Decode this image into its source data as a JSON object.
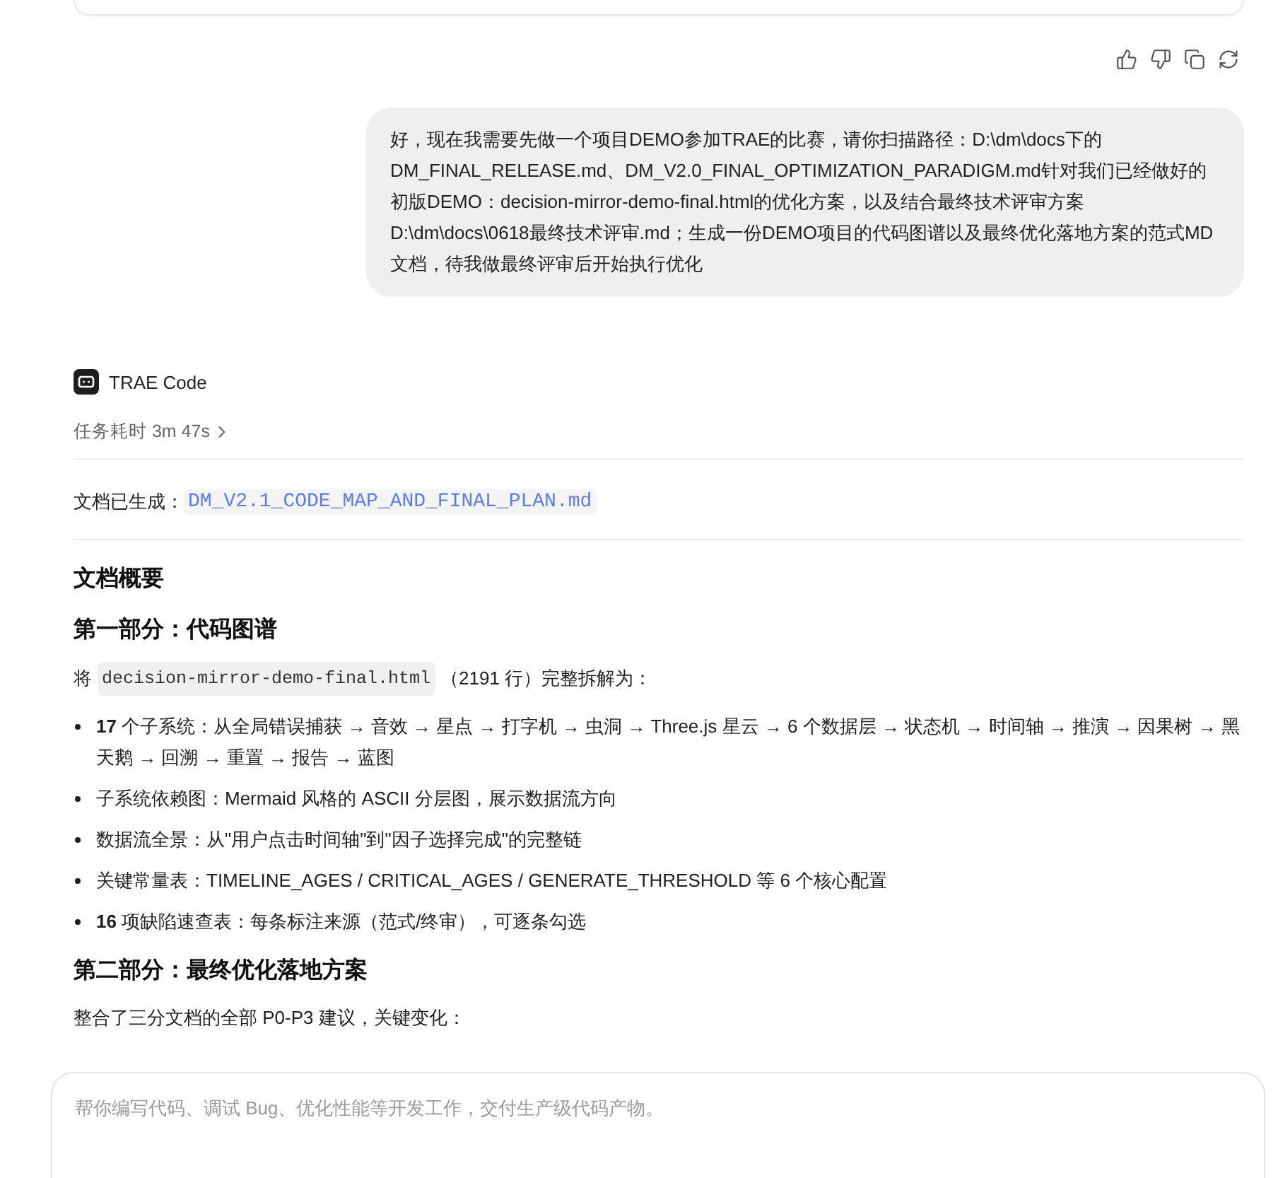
{
  "message_actions": [
    {
      "kind": "like"
    },
    {
      "kind": "dislike"
    },
    {
      "kind": "copy"
    },
    {
      "kind": "regenerate"
    }
  ],
  "user_message": {
    "text": "好，现在我需要先做一个项目DEMO参加TRAE的比赛，请你扫描路径：D:\\dm\\docs下的DM_FINAL_RELEASE.md、DM_V2.0_FINAL_OPTIMIZATION_PARADIGM.md针对我们已经做好的初版DEMO：decision-mirror-demo-final.html的优化方案，以及结合最终技术评审方案D:\\dm\\docs\\0618最终技术评审.md；生成一份DEMO项目的代码图谱以及最终优化落地方案的范式MD文档，待我做最终评审后开始执行优化"
  },
  "assistant": {
    "name": "TRAE Code",
    "duration": "任务耗时 3m 47s",
    "generated_label": "文档已生成：",
    "generated_file": "DM_V2.1_CODE_MAP_AND_FINAL_PLAN.md",
    "blocks": [
      {
        "kind": "heading",
        "text": "文档概要"
      },
      {
        "kind": "heading",
        "text": "第一部分：代码图谱"
      },
      {
        "kind": "code_paragraph",
        "before": "将",
        "code": "decision-mirror-demo-final.html",
        "after": "（2191 行）完整拆解为："
      },
      {
        "kind": "list",
        "items": [
          "**17** 个子系统：从全局错误捕获 → 音效 → 星点 → 打字机 → 虫洞 → Three.js 星云 → 6 个数据层 → 状态机 → 时间轴 → 推演 → 因果树 → 黑天鹅 → 回溯 → 重置 → 报告 → 蓝图",
          "子系统依赖图：Mermaid 风格的 ASCII 分层图，展示数据流方向",
          "数据流全景：从\"用户点击时间轴\"到\"因子选择完成\"的完整链",
          "关键常量表：TIMELINE_AGES / CRITICAL_AGES / GENERATE_THRESHOLD 等 6 个核心配置",
          "**16** 项缺陷速查表：每条标注来源（范式/终审），可逐条勾选"
        ]
      },
      {
        "kind": "heading",
        "text": "第二部分：最终优化落地方案"
      },
      {
        "kind": "paragraph",
        "text": "整合了三分文档的全部 P0-P3 建议，关键变化："
      }
    ]
  },
  "composer": {
    "placeholder": "帮你编写代码、调试 Bug、优化性能等开发工作，交付生产级代码产物。"
  }
}
